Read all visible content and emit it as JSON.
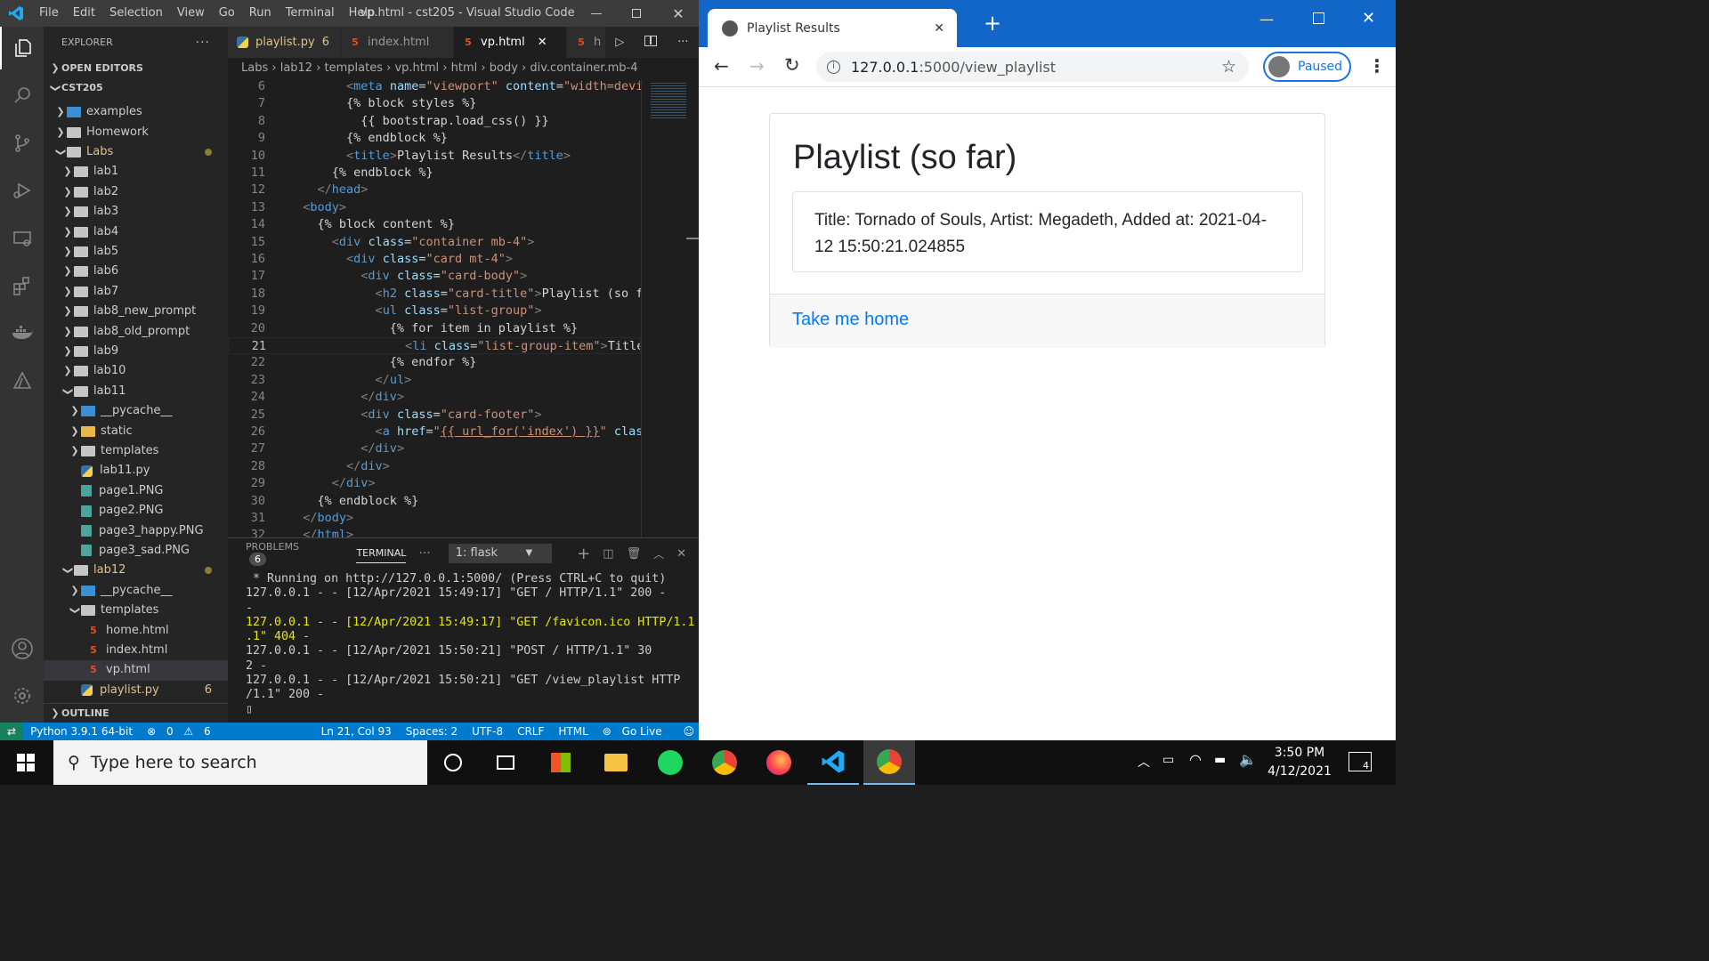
{
  "vscode": {
    "menu": [
      "File",
      "Edit",
      "Selection",
      "View",
      "Go",
      "Run",
      "Terminal",
      "Help"
    ],
    "window_title": "vp.html - cst205 - Visual Studio Code",
    "explorer_title": "EXPLORER",
    "explorer_more": "···",
    "open_editors": "OPEN EDITORS",
    "project": "CST205",
    "tree": [
      {
        "label": "examples",
        "depth": 1,
        "type": "folder-special",
        "open": false
      },
      {
        "label": "Homework",
        "depth": 1,
        "type": "folder",
        "open": false
      },
      {
        "label": "Labs",
        "depth": 1,
        "type": "folder",
        "open": true,
        "dot": true,
        "color": "#e2c08d"
      },
      {
        "label": "lab1",
        "depth": 2,
        "type": "folder",
        "open": false
      },
      {
        "label": "lab2",
        "depth": 2,
        "type": "folder",
        "open": false
      },
      {
        "label": "lab3",
        "depth": 2,
        "type": "folder",
        "open": false
      },
      {
        "label": "lab4",
        "depth": 2,
        "type": "folder",
        "open": false
      },
      {
        "label": "lab5",
        "depth": 2,
        "type": "folder",
        "open": false
      },
      {
        "label": "lab6",
        "depth": 2,
        "type": "folder",
        "open": false
      },
      {
        "label": "lab7",
        "depth": 2,
        "type": "folder",
        "open": false
      },
      {
        "label": "lab8_new_prompt",
        "depth": 2,
        "type": "folder",
        "open": false
      },
      {
        "label": "lab8_old_prompt",
        "depth": 2,
        "type": "folder",
        "open": false
      },
      {
        "label": "lab9",
        "depth": 2,
        "type": "folder",
        "open": false
      },
      {
        "label": "lab10",
        "depth": 2,
        "type": "folder",
        "open": false
      },
      {
        "label": "lab11",
        "depth": 2,
        "type": "folder",
        "open": true
      },
      {
        "label": "__pycache__",
        "depth": 3,
        "type": "folder-special",
        "open": false
      },
      {
        "label": "static",
        "depth": 3,
        "type": "folder-yellow",
        "open": false
      },
      {
        "label": "templates",
        "depth": 3,
        "type": "folder",
        "open": false
      },
      {
        "label": "lab11.py",
        "depth": 3,
        "type": "py"
      },
      {
        "label": "page1.PNG",
        "depth": 3,
        "type": "png"
      },
      {
        "label": "page2.PNG",
        "depth": 3,
        "type": "png"
      },
      {
        "label": "page3_happy.PNG",
        "depth": 3,
        "type": "png"
      },
      {
        "label": "page3_sad.PNG",
        "depth": 3,
        "type": "png"
      },
      {
        "label": "lab12",
        "depth": 2,
        "type": "folder",
        "open": true,
        "dot": true,
        "color": "#e2c08d"
      },
      {
        "label": "__pycache__",
        "depth": 3,
        "type": "folder-special",
        "open": false
      },
      {
        "label": "templates",
        "depth": 3,
        "type": "folder",
        "open": true
      },
      {
        "label": "home.html",
        "depth": 4,
        "type": "html"
      },
      {
        "label": "index.html",
        "depth": 4,
        "type": "html"
      },
      {
        "label": "vp.html",
        "depth": 4,
        "type": "html",
        "selected": true
      },
      {
        "label": "playlist.py",
        "depth": 3,
        "type": "py",
        "color": "#e2c08d",
        "count": "6"
      }
    ],
    "outline": "OUTLINE",
    "tabs": [
      {
        "label": "playlist.py",
        "count": "6",
        "type": "py"
      },
      {
        "label": "index.html",
        "type": "html"
      },
      {
        "label": "vp.html",
        "type": "html",
        "active": true,
        "close": "✕"
      },
      {
        "label": "h",
        "type": "html"
      }
    ],
    "breadcrumb": [
      "Labs",
      "lab12",
      "templates",
      "vp.html",
      "html",
      "body",
      "div.container.mb-4"
    ],
    "code": [
      {
        "n": "6",
        "html": "        <span class='br'>&lt;</span><span class='tg'>meta</span> <span class='at'>name</span>=<span class='st'>\"viewport\"</span> <span class='at'>content</span>=<span class='st'>\"width=device-w</span>"
      },
      {
        "n": "7",
        "html": "        <span class='tx'>{% block styles %}</span>"
      },
      {
        "n": "8",
        "html": "          <span class='tx'>{{ bootstrap.load_css() }}</span>"
      },
      {
        "n": "9",
        "html": "        <span class='tx'>{% endblock %}</span>"
      },
      {
        "n": "10",
        "html": "        <span class='br'>&lt;</span><span class='tg'>title</span><span class='br'>&gt;</span><span class='tx'>Playlist Results</span><span class='br'>&lt;/</span><span class='tg'>title</span><span class='br'>&gt;</span>"
      },
      {
        "n": "11",
        "html": "      <span class='tx'>{% endblock %}</span>"
      },
      {
        "n": "12",
        "html": "    <span class='br'>&lt;/</span><span class='tg'>head</span><span class='br'>&gt;</span>"
      },
      {
        "n": "13",
        "html": "  <span class='br'>&lt;</span><span class='tg'>body</span><span class='br'>&gt;</span>"
      },
      {
        "n": "14",
        "html": "    <span class='tx'>{% block content %}</span>"
      },
      {
        "n": "15",
        "html": "      <span class='br'>&lt;</span><span class='tg'>div</span> <span class='at'>class</span>=<span class='st'>\"container mb-4\"</span><span class='br'>&gt;</span>"
      },
      {
        "n": "16",
        "html": "        <span class='br'>&lt;</span><span class='tg'>div</span> <span class='at'>class</span>=<span class='st'>\"card mt-4\"</span><span class='br'>&gt;</span>"
      },
      {
        "n": "17",
        "html": "          <span class='br'>&lt;</span><span class='tg'>div</span> <span class='at'>class</span>=<span class='st'>\"card-body\"</span><span class='br'>&gt;</span>"
      },
      {
        "n": "18",
        "html": "            <span class='br'>&lt;</span><span class='tg'>h2</span> <span class='at'>class</span>=<span class='st'>\"card-title\"</span><span class='br'>&gt;</span><span class='tx'>Playlist (so far)</span><span class='br'>&lt;</span>"
      },
      {
        "n": "19",
        "html": "            <span class='br'>&lt;</span><span class='tg'>ul</span> <span class='at'>class</span>=<span class='st'>\"list-group\"</span><span class='br'>&gt;</span>"
      },
      {
        "n": "20",
        "html": "              <span class='tx'>{% for item in playlist %}</span>"
      },
      {
        "n": "21",
        "html": "                <span class='br'>&lt;</span><span class='tg'>li</span> <span class='at'>class</span>=<span class='st'>\"list-group-item\"</span><span class='br'>&gt;</span><span class='tx'>Title: {{</span>",
        "cur": true
      },
      {
        "n": "22",
        "html": "              <span class='tx'>{% endfor %}</span>"
      },
      {
        "n": "23",
        "html": "            <span class='br'>&lt;/</span><span class='tg'>ul</span><span class='br'>&gt;</span>"
      },
      {
        "n": "24",
        "html": "          <span class='br'>&lt;/</span><span class='tg'>div</span><span class='br'>&gt;</span>"
      },
      {
        "n": "25",
        "html": "          <span class='br'>&lt;</span><span class='tg'>div</span> <span class='at'>class</span>=<span class='st'>\"card-footer\"</span><span class='br'>&gt;</span>"
      },
      {
        "n": "26",
        "html": "            <span class='br'>&lt;</span><span class='tg'>a</span> <span class='at'>href</span>=<span class='st'>\"<u>{{ url_for('index') }}</u>\"</span> <span class='at'>class</span>=<span class='st'>\"c</span>"
      },
      {
        "n": "27",
        "html": "          <span class='br'>&lt;/</span><span class='tg'>div</span><span class='br'>&gt;</span>"
      },
      {
        "n": "28",
        "html": "        <span class='br'>&lt;/</span><span class='tg'>div</span><span class='br'>&gt;</span>"
      },
      {
        "n": "29",
        "html": "      <span class='br'>&lt;/</span><span class='tg'>div</span><span class='br'>&gt;</span>"
      },
      {
        "n": "30",
        "html": "    <span class='tx'>{% endblock %}</span>"
      },
      {
        "n": "31",
        "html": "  <span class='br'>&lt;/</span><span class='tg'>body</span><span class='br'>&gt;</span>"
      },
      {
        "n": "32",
        "html": "  <span class='br'>&lt;/</span><span class='tg'>html</span><span class='br'>&gt;</span>"
      }
    ],
    "panel": {
      "problems": "PROBLEMS",
      "problems_count": "6",
      "terminal": "TERMINAL",
      "more": "···",
      "terminal_select": "1: flask",
      "lines": [
        " * Running on http://127.0.0.1:5000/ (Press CTRL+C to quit)",
        "127.0.0.1 - - [12/Apr/2021 15:49:17] \"GET / HTTP/1.1\" 200 -",
        "-",
        "127.0.0.1 - - [12/Apr/2021 15:49:17] \"GET /favicon.ico HTTP/1.1",
        ".1\" 404 -",
        "127.0.0.1 - - [12/Apr/2021 15:50:21] \"POST / HTTP/1.1\" 30",
        "2 -",
        "127.0.0.1 - - [12/Apr/2021 15:50:21] \"GET /view_playlist HTTP",
        "/1.1\" 200 -"
      ]
    },
    "status": {
      "python": "Python 3.9.1 64-bit",
      "errors": "0",
      "warnings": "6",
      "position": "Ln 21, Col 93",
      "spaces": "Spaces: 2",
      "encoding": "UTF-8",
      "eol": "CRLF",
      "lang": "HTML",
      "golive": "Go Live"
    }
  },
  "browser": {
    "tab_title": "Playlist Results",
    "url_host": "127.0.0.1",
    "url_path": ":5000/view_playlist",
    "profile": "Paused",
    "heading": "Playlist (so far)",
    "item": "Title: Tornado of Souls, Artist: Megadeth, Added at: 2021-04-12 15:50:21.024855",
    "link": "Take me home"
  },
  "taskbar": {
    "search_placeholder": "Type here to search",
    "time": "3:50 PM",
    "date": "4/12/2021",
    "notification_count": "4"
  }
}
